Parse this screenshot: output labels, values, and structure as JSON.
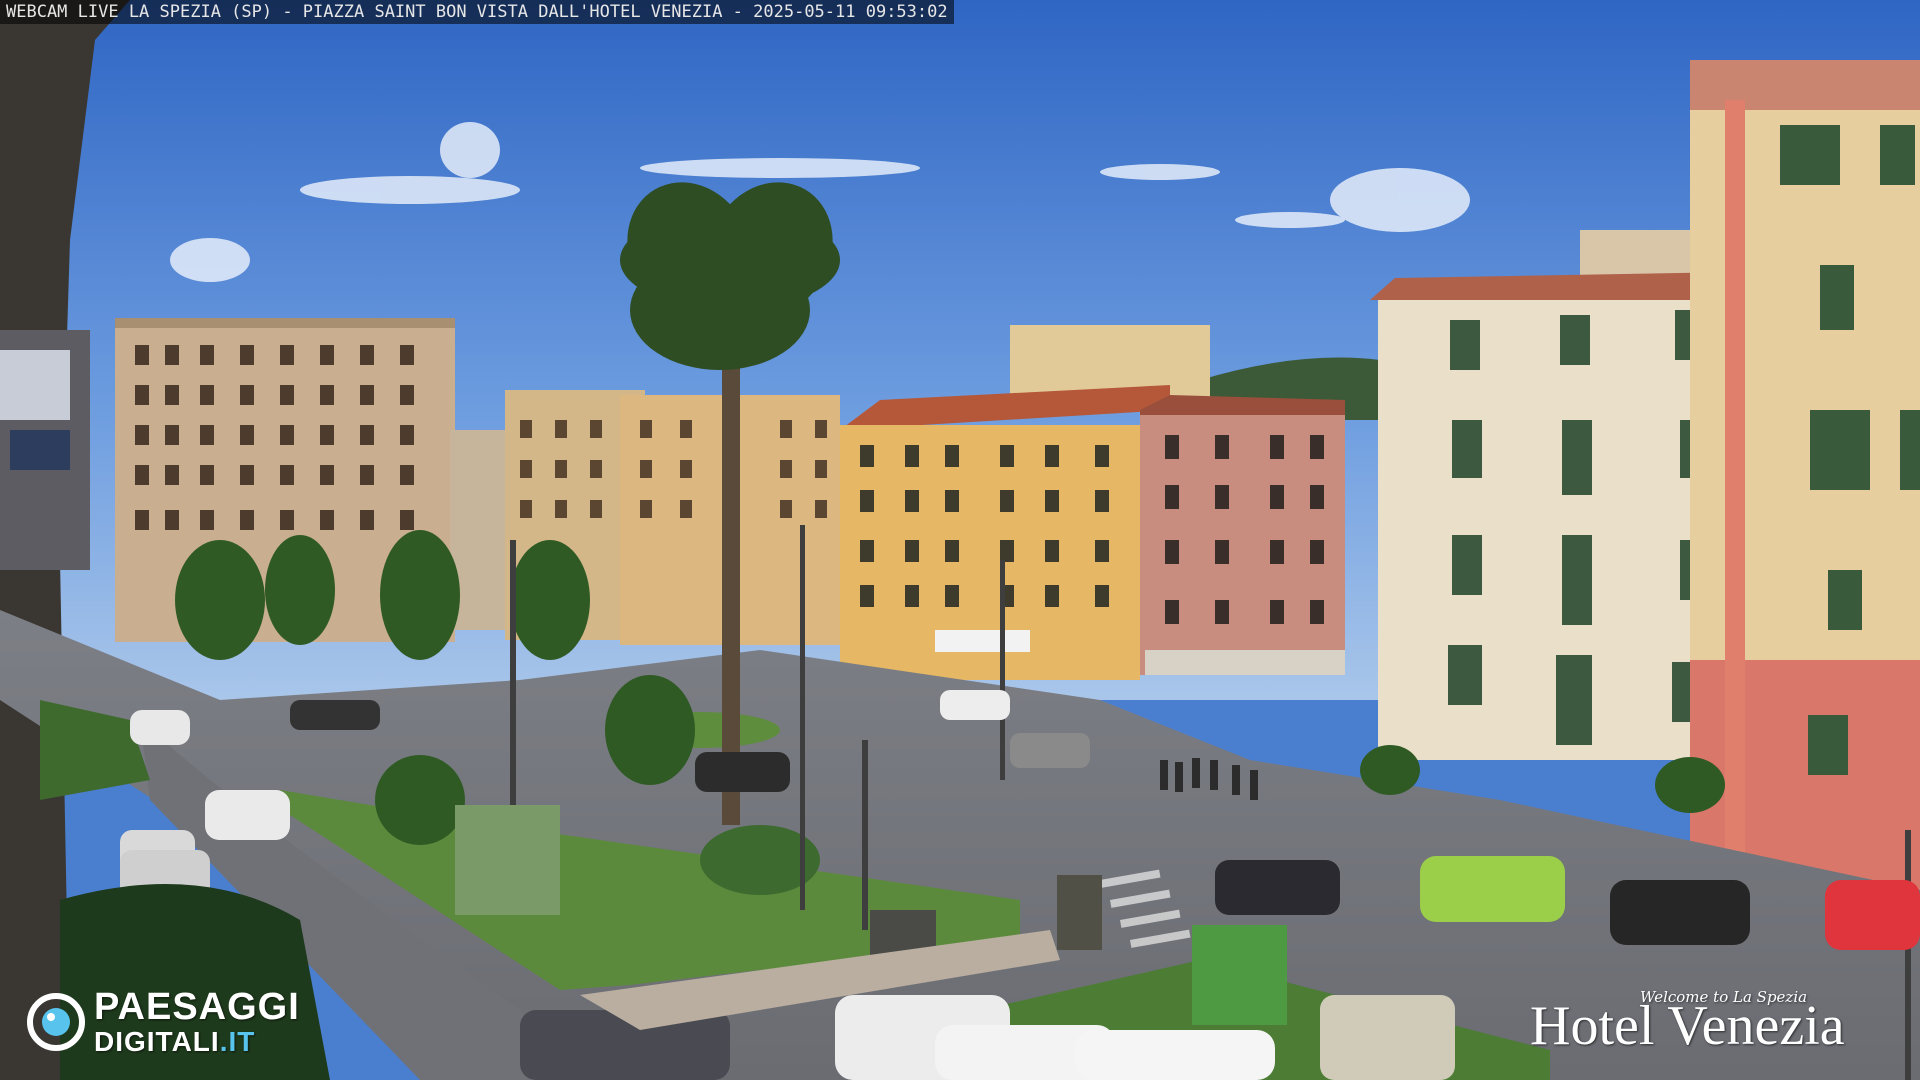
{
  "overlay": {
    "title": "WEBCAM LIVE LA SPEZIA (SP) - PIAZZA SAINT BON VISTA DALL'HOTEL VENEZIA - 2025-05-11 09:53:02"
  },
  "branding_left": {
    "line1": "PAESAGGI",
    "line2_main": "DIGITALI",
    "line2_accent": ".IT",
    "icon": "camera-lens-icon"
  },
  "branding_right": {
    "welcome": "Welcome to La Spezia",
    "hotel_name": "Hotel Venezia"
  },
  "colors": {
    "sky": "#4a7fd0",
    "brand_accent": "#58c4ee"
  }
}
